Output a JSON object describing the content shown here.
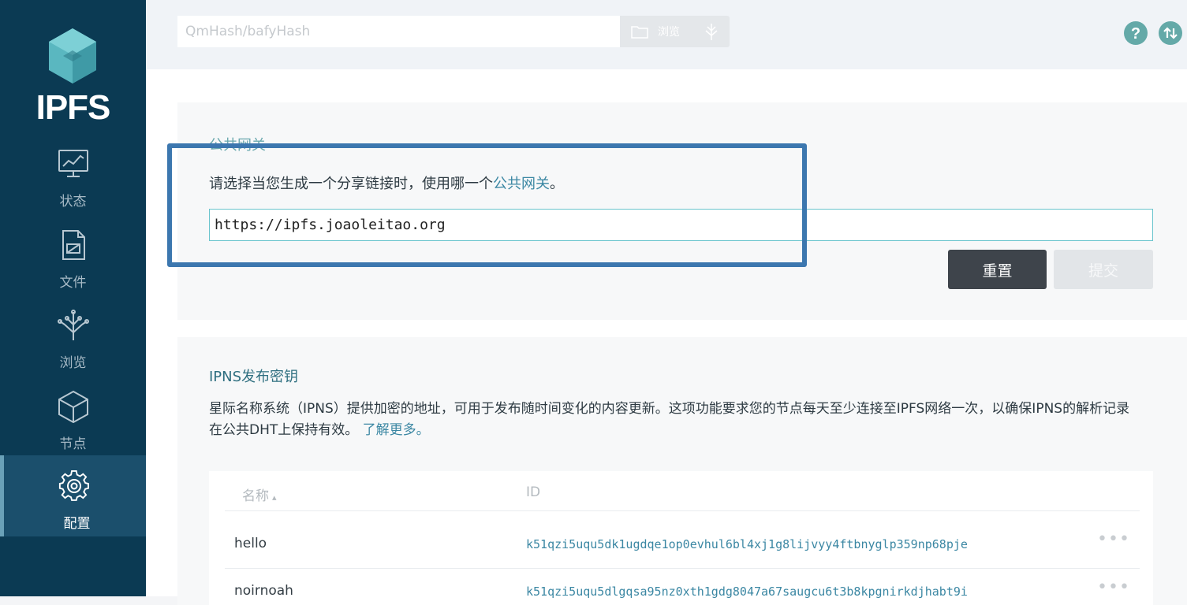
{
  "sidebar": {
    "logo_text": "IPFS",
    "items": [
      {
        "label": "状态",
        "icon": "status-monitor-icon"
      },
      {
        "label": "文件",
        "icon": "file-icon"
      },
      {
        "label": "浏览",
        "icon": "tree-icon"
      },
      {
        "label": "节点",
        "icon": "cube-icon"
      },
      {
        "label": "配置",
        "icon": "gear-icon",
        "active": true
      }
    ]
  },
  "topbar": {
    "search_placeholder": "QmHash/bafyHash",
    "browse_label": "浏览",
    "icons": [
      "help-icon",
      "transfer-icon"
    ]
  },
  "gateway": {
    "title": "公共网关",
    "desc_prefix": "请选择当您生成一个分享链接时，使用哪一个",
    "desc_link": "公共网关",
    "desc_suffix": "。",
    "value": "https://ipfs.joaoleitao.org",
    "reset_label": "重置",
    "submit_label": "提交"
  },
  "ipns": {
    "title": "IPNS发布密钥",
    "desc": "星际名称系统（IPNS）提供加密的地址，可用于发布随时间变化的内容更新。这项功能要求您的节点每天至少连接至IPFS网络一次，以确保IPNS的解析记录在公共DHT上保持有效。",
    "learn_more": "了解更多。",
    "columns": {
      "name": "名称",
      "sort_indicator": "▴",
      "id": "ID"
    },
    "rows": [
      {
        "name": "hello",
        "id": "k51qzi5uqu5dk1ugdqe1op0evhul6bl4xj1g8lijvyy4ftbnyglp359np68pje",
        "menu": "•••"
      },
      {
        "name": "noirnoah",
        "id": "k51qzi5uqu5dlgqsa95nz0xth1gdg8047a67saugcu6t3b8kpgnirkdjhabt9i",
        "menu": "•••"
      }
    ]
  },
  "colors": {
    "sidebar_bg": "#0b3a53",
    "accent_teal": "#69c4cd",
    "link": "#3b87a3",
    "highlight_border": "#3c77af"
  }
}
